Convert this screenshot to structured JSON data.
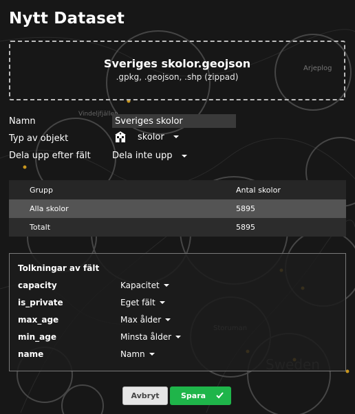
{
  "page": {
    "title": "Nytt Dataset"
  },
  "dropzone": {
    "filename": "Sveriges skolor.geojson",
    "hint": ".gpkg, .geojson, .shp (zippad)"
  },
  "form": {
    "name_label": "Namn",
    "name_value": "Sveriges skolor",
    "type_label": "Typ av objekt",
    "type_value": "skolor",
    "type_icon": "school-icon",
    "split_label": "Dela upp efter fält",
    "split_value": "Dela inte upp"
  },
  "table": {
    "headers": [
      "Grupp",
      "Antal skolor"
    ],
    "rows": [
      {
        "group": "Alla skolor",
        "count": "5895"
      },
      {
        "group": "Totalt",
        "count": "5895"
      }
    ]
  },
  "fields": {
    "title": "Tolkningar av fält",
    "items": [
      {
        "field": "capacity",
        "interpretation": "Kapacitet"
      },
      {
        "field": "is_private",
        "interpretation": "Eget fält"
      },
      {
        "field": "max_age",
        "interpretation": "Max ålder"
      },
      {
        "field": "min_age",
        "interpretation": "Minsta ålder"
      },
      {
        "field": "name",
        "interpretation": "Namn"
      }
    ]
  },
  "buttons": {
    "cancel": "Avbryt",
    "save": "Spara"
  },
  "map": {
    "labels": [
      "Arjeplog",
      "Vindeljfjällen",
      "Storuman",
      "Sweden"
    ]
  },
  "colors": {
    "save": "#1fb54a",
    "marker": "#c8961e"
  }
}
